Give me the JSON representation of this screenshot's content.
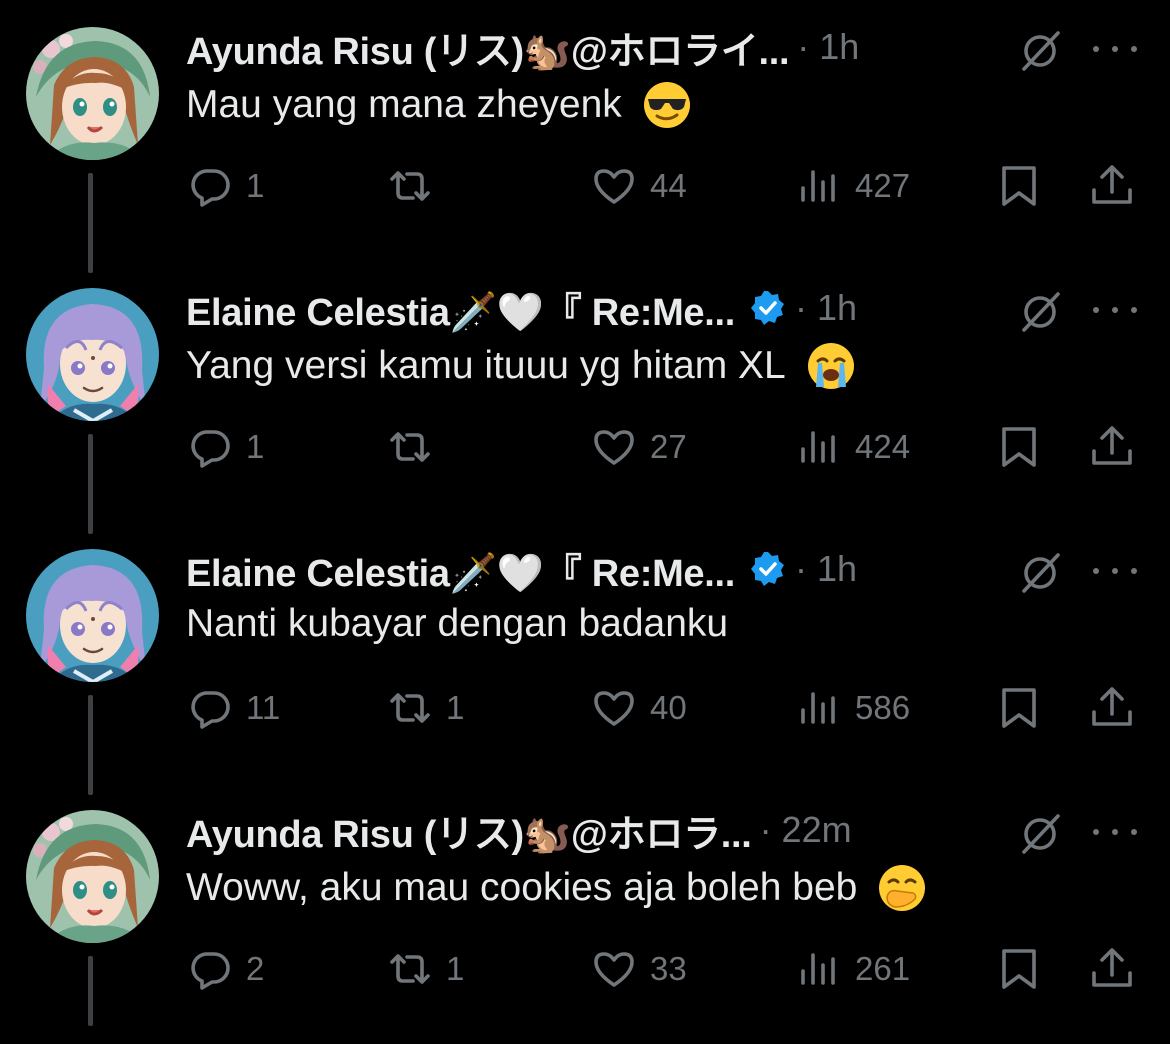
{
  "tweets": [
    {
      "name": "Ayunda Risu (リス)🐿️@ホロライ...",
      "meta": "· 1h",
      "verified": false,
      "text": "Mau yang mana zheyenk",
      "emoji": "sunglasses-face",
      "avatar": "risu",
      "replies": "1",
      "retweets": "",
      "likes": "44",
      "views": "427"
    },
    {
      "name": "Elaine Celestia🗡️🤍『 Re:Me...",
      "meta": "· 1h",
      "verified": true,
      "text": "Yang versi kamu ituuu yg hitam XL",
      "emoji": "crying-face",
      "avatar": "elaine",
      "replies": "1",
      "retweets": "",
      "likes": "27",
      "views": "424"
    },
    {
      "name": "Elaine Celestia🗡️🤍『 Re:Me...",
      "meta": "· 1h",
      "verified": true,
      "text": "Nanti kubayar dengan badanku",
      "emoji": "",
      "avatar": "elaine",
      "replies": "11",
      "retweets": "1",
      "likes": "40",
      "views": "586"
    },
    {
      "name": "Ayunda Risu (リス)🐿️@ホロラ...",
      "meta": "· 22m",
      "verified": false,
      "text": "Woww, aku mau cookies aja boleh beb",
      "emoji": "hand-over-mouth-face",
      "avatar": "risu",
      "replies": "2",
      "retweets": "1",
      "likes": "33",
      "views": "261"
    }
  ],
  "colors": {
    "background": "#000000",
    "text": "#e7e9ea",
    "muted": "#71767b",
    "thread_line": "#3e4144",
    "verified": "#1d9bf0"
  },
  "icons": [
    "reply-icon",
    "retweet-icon",
    "like-icon",
    "views-icon",
    "bookmark-icon",
    "share-icon",
    "grok-icon",
    "more-icon",
    "verified-badge-icon"
  ]
}
